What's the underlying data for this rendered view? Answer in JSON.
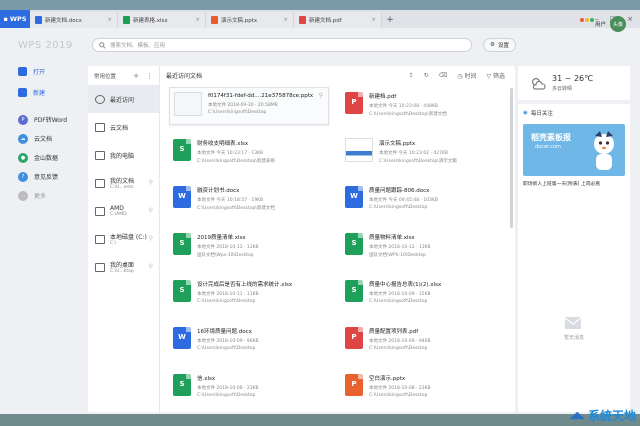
{
  "tabbar": {
    "logo": "WPS",
    "tabs": [
      {
        "label": "新建文档.docx",
        "color": "#2d6be0"
      },
      {
        "label": "新建表格.xlsx",
        "color": "#1e9e52"
      },
      {
        "label": "演示文稿.pptx",
        "color": "#e65c2f"
      },
      {
        "label": "新建文档.pdf",
        "color": "#e04545"
      }
    ],
    "close": "×",
    "plus": "+"
  },
  "header": {
    "brand": "WPS 2019",
    "search_placeholder": "搜索文档、模板、应用",
    "settings": "设置",
    "user_name": "用户",
    "avatar_text": "头像"
  },
  "sidebar": {
    "items": [
      {
        "label": "打开",
        "color": "#2d6be0"
      },
      {
        "label": "新建",
        "color": "#2d6be0"
      },
      {
        "label": "PDF转Word",
        "color": "#5b6bd6"
      },
      {
        "label": "云文档",
        "color": "#3f8fe0"
      },
      {
        "label": "金山数据",
        "color": "#2ba66b"
      },
      {
        "label": "意见反馈",
        "color": "#3f8fe0"
      },
      {
        "label": "更多",
        "color": "#999999"
      }
    ]
  },
  "locations": {
    "title": "常用位置",
    "items": [
      {
        "label": "最近访问",
        "sub": ""
      },
      {
        "label": "云文档",
        "sub": ""
      },
      {
        "label": "我的电脑",
        "sub": ""
      },
      {
        "label": "我的文档",
        "sub": "C:\\U...ents"
      },
      {
        "label": "AMD",
        "sub": "C:\\AMD"
      },
      {
        "label": "本地磁盘 (C:)",
        "sub": "C:\\"
      },
      {
        "label": "我的桌面",
        "sub": "C:\\U...ktop"
      }
    ]
  },
  "recent": {
    "title": "最近访问文档",
    "sort": "时间",
    "filter": "筛选",
    "files": [
      {
        "name": "f0174f31-fdef-dd....21e375878ce.pptx",
        "meta": "本地文件 2018-09-30 · 20.58MB",
        "path": "C:\\Users\\kingsoft\\Desktop",
        "kind": "thumb"
      },
      {
        "name": "新建档.pdf",
        "meta": "本地文件 今天 10:23:08 · 448KB",
        "path": "C:\\Users\\kingsoft\\Desktop\\新建文档",
        "kind": "pdf"
      },
      {
        "name": "财务收支明细表.xlsx",
        "meta": "本地文件 今天 10:23:17 · 13KB",
        "path": "C:\\Users\\kingsoft\\Desktop\\新建表格",
        "kind": "xlsx"
      },
      {
        "name": "演示文稿.pptx",
        "meta": "本地文件 今天 10:23:02 · 427KB",
        "path": "C:\\Users\\kingsoft\\Desktop\\演示文稿",
        "kind": "thumb2"
      },
      {
        "name": "融资计划书.docx",
        "meta": "本地文件 今天 10:18:57 · 19KB",
        "path": "C:\\Users\\kingsoft\\Desktop\\新建文档",
        "kind": "docx"
      },
      {
        "name": "质量问题跟踪-806.docx",
        "meta": "本地文件 今天 09:45:48 · 103KB",
        "path": "C:\\Users\\kingsoft\\Desktop",
        "kind": "docx"
      },
      {
        "name": "2019质量清单.xlsx",
        "meta": "本地文件 2018-10-12 · 13KB",
        "path": "国队文档\\Wps-10\\Desktop",
        "kind": "xlsx"
      },
      {
        "name": "质量物料清单.xlsx",
        "meta": "本地文件 2018-10-12 · 13KB",
        "path": "国队文档\\WPS-10\\Desktop",
        "kind": "xlsx"
      },
      {
        "name": "设计完成后是否有上线的需求统计.xlsx",
        "meta": "本地文件 2018-10-11 · 11KB",
        "path": "C:\\Users\\kingsoft\\Desktop",
        "kind": "xlsx"
      },
      {
        "name": "质量中心报告总表(1)(2).xlsx",
        "meta": "本地文件 2018-10-09 · 15KB",
        "path": "C:\\Users\\kingsoft\\Desktop",
        "kind": "xlsx"
      },
      {
        "name": "16环境质量问题.docx",
        "meta": "本地文件 2018-10-09 · 96KB",
        "path": "C:\\Users\\kingsoft\\Desktop",
        "kind": "docx"
      },
      {
        "name": "质量配置项列表.pdf",
        "meta": "本地文件 2018-10-09 · 94KB",
        "path": "C:\\Users\\kingsoft\\Desktop",
        "kind": "pdf"
      },
      {
        "name": "信.xlsx",
        "meta": "本地文件 2018-10-08 · 23KB",
        "path": "C:\\Users\\kingsoft\\Desktop",
        "kind": "xlsx"
      },
      {
        "name": "空白演示.pptx",
        "meta": "本地文件 2018-10-08 · 23KB",
        "path": "C:\\Users\\kingsoft\\Desktop",
        "kind": "pptx"
      }
    ]
  },
  "weather": {
    "temp": "31 ~ 26℃",
    "desc": "多云转晴"
  },
  "notice": {
    "title": "每日关注",
    "ad_title": "稻壳素板报",
    "ad_site": "docer.com",
    "ad_caption": "职场新人上班第一天(附表) 上岗必看",
    "empty": "暂无消息"
  },
  "watermark": "系统天地",
  "colors": {
    "docx": "#2d6be0",
    "xlsx": "#1ea05a",
    "pdf": "#e04545",
    "pptx": "#e8622f",
    "accent": "#2d6be0"
  }
}
